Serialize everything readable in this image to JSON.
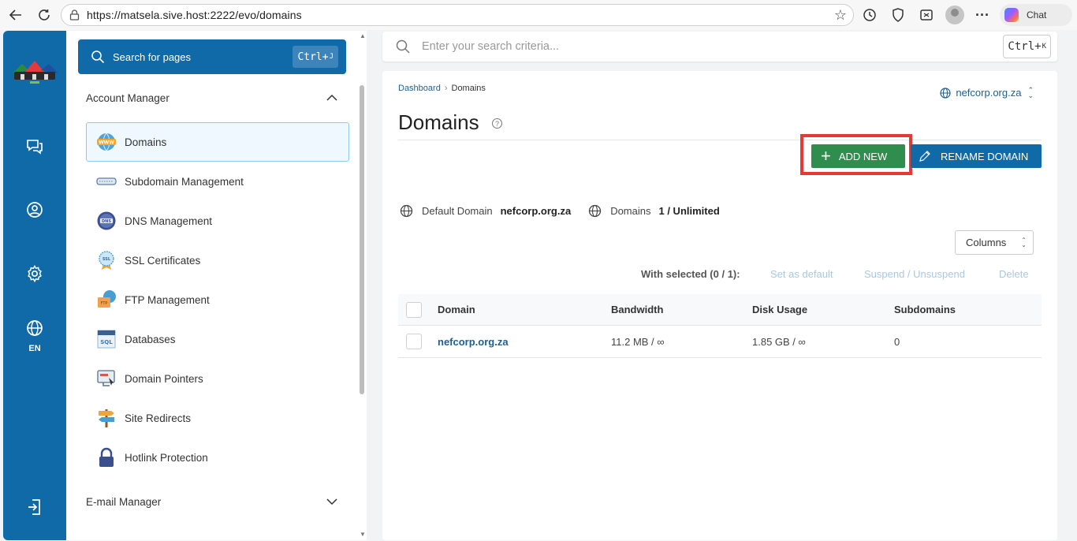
{
  "browser": {
    "url": "https://matsela.sive.host:2222/evo/domains",
    "chat_label": "Chat"
  },
  "rail": {
    "items": [
      "chat-icon",
      "user-icon",
      "gear-icon",
      "globe-icon",
      "logout-icon"
    ],
    "language": "EN"
  },
  "sidebar": {
    "search_label": "Search for pages",
    "search_shortcut": "Ctrl+",
    "search_shortcut_key": "J",
    "sections": {
      "account_manager": "Account Manager",
      "email_manager": "E-mail Manager"
    },
    "items": [
      {
        "label": "Domains",
        "icon": "www-globe-icon",
        "active": true
      },
      {
        "label": "Subdomain Management",
        "icon": "subdomain-icon"
      },
      {
        "label": "DNS Management",
        "icon": "dns-icon"
      },
      {
        "label": "SSL Certificates",
        "icon": "ssl-badge-icon"
      },
      {
        "label": "FTP Management",
        "icon": "ftp-folder-icon"
      },
      {
        "label": "Databases",
        "icon": "sql-database-icon"
      },
      {
        "label": "Domain Pointers",
        "icon": "domain-pointer-icon"
      },
      {
        "label": "Site Redirects",
        "icon": "signpost-icon"
      },
      {
        "label": "Hotlink Protection",
        "icon": "lock-icon"
      }
    ]
  },
  "main_search": {
    "placeholder": "Enter your search criteria...",
    "shortcut": "Ctrl+",
    "shortcut_key": "K"
  },
  "page": {
    "breadcrumb": [
      "Dashboard",
      "Domains"
    ],
    "selected_domain": "nefcorp.org.za",
    "title": "Domains",
    "add_new_label": "ADD NEW",
    "rename_label": "RENAME DOMAIN",
    "default_domain_label": "Default Domain",
    "default_domain_value": "nefcorp.org.za",
    "domains_label": "Domains",
    "domains_value": "1 / Unlimited",
    "columns_label": "Columns",
    "bulk": {
      "with_selected": "With selected (0 / 1):",
      "set_default": "Set as default",
      "suspend": "Suspend / Unsuspend",
      "delete": "Delete"
    },
    "table": {
      "headers": [
        "Domain",
        "Bandwidth",
        "Disk Usage",
        "Subdomains"
      ],
      "rows": [
        {
          "domain": "nefcorp.org.za",
          "bandwidth": "11.2 MB / ∞",
          "disk": "1.85 GB / ∞",
          "subdomains": "0"
        }
      ]
    }
  },
  "colors": {
    "brand_blue": "#116aa8",
    "add_green": "#2f8e4e",
    "highlight_red": "#e53935",
    "link_blue": "#1d5f93"
  }
}
